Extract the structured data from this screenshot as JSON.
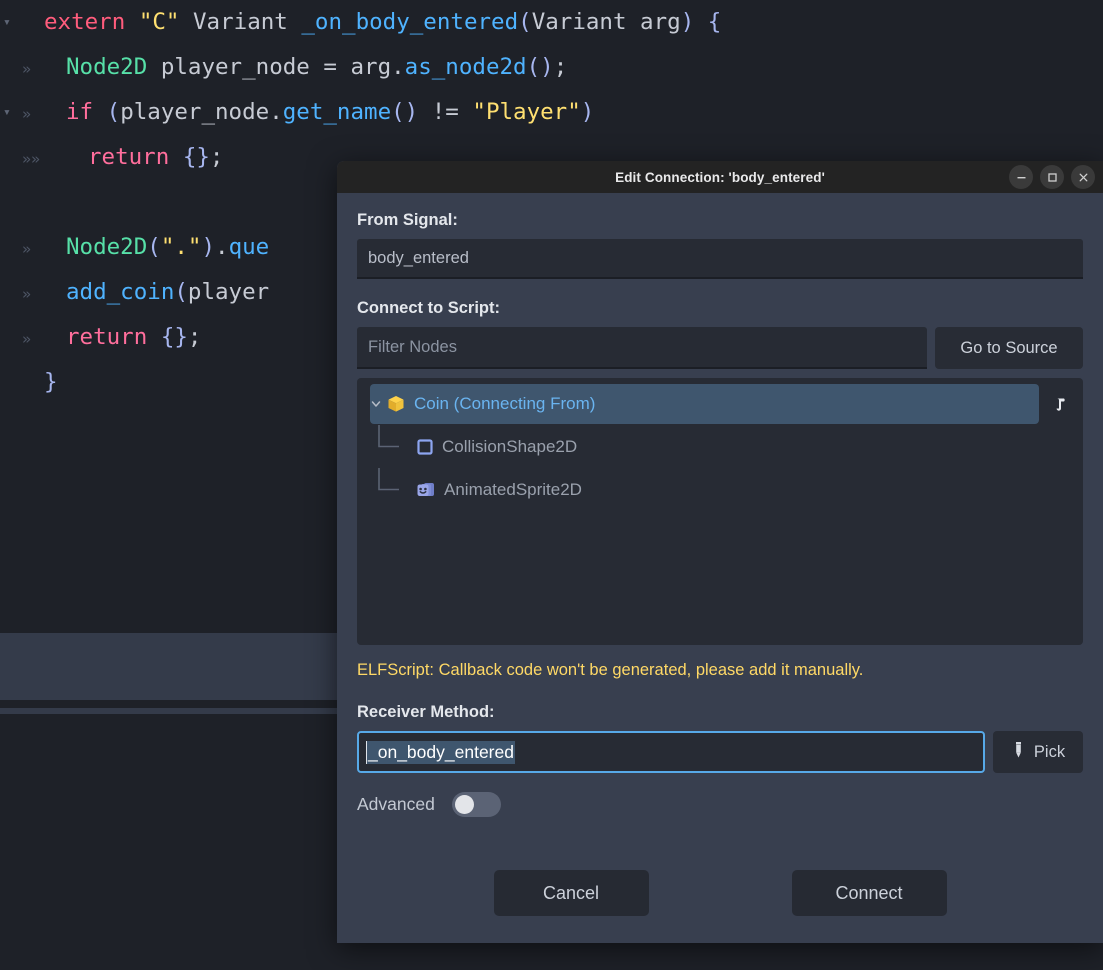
{
  "editor": {
    "lines": [
      {
        "fold": "▾",
        "gutter": "",
        "indent": 0,
        "tokens": [
          {
            "t": "extern",
            "c": "k-kw"
          },
          {
            "t": " ",
            "c": "k-pln"
          },
          {
            "t": "\"C\"",
            "c": "k-str"
          },
          {
            "t": " ",
            "c": "k-pln"
          },
          {
            "t": "Variant",
            "c": "k-type"
          },
          {
            "t": " ",
            "c": "k-pln"
          },
          {
            "t": "_on_body_entered",
            "c": "k-fn"
          },
          {
            "t": "(",
            "c": "k-brc"
          },
          {
            "t": "Variant",
            "c": "k-type"
          },
          {
            "t": " arg",
            "c": "k-pln"
          },
          {
            "t": ")",
            "c": "k-brc"
          },
          {
            "t": " ",
            "c": "k-pln"
          },
          {
            "t": "{",
            "c": "k-brc"
          }
        ]
      },
      {
        "fold": "",
        "gutter": "»",
        "indent": 1,
        "tokens": [
          {
            "t": "Node2D",
            "c": "k-cls"
          },
          {
            "t": " player_node ",
            "c": "k-pln"
          },
          {
            "t": "=",
            "c": "k-op"
          },
          {
            "t": " arg.",
            "c": "k-pln"
          },
          {
            "t": "as_node2d",
            "c": "k-mem"
          },
          {
            "t": "()",
            "c": "k-brc"
          },
          {
            "t": ";",
            "c": "k-pln"
          }
        ]
      },
      {
        "fold": "▾",
        "gutter": "»",
        "indent": 1,
        "tokens": [
          {
            "t": "if",
            "c": "k-kw2"
          },
          {
            "t": " ",
            "c": "k-pln"
          },
          {
            "t": "(",
            "c": "k-brc"
          },
          {
            "t": "player_node.",
            "c": "k-pln"
          },
          {
            "t": "get_name",
            "c": "k-mem"
          },
          {
            "t": "()",
            "c": "k-brc"
          },
          {
            "t": " != ",
            "c": "k-pln"
          },
          {
            "t": "\"Player\"",
            "c": "k-str"
          },
          {
            "t": ")",
            "c": "k-brc"
          }
        ]
      },
      {
        "fold": "",
        "gutter": "»»",
        "indent": 2,
        "tokens": [
          {
            "t": "return",
            "c": "k-kw2"
          },
          {
            "t": " ",
            "c": "k-pln"
          },
          {
            "t": "{}",
            "c": "k-brc"
          },
          {
            "t": ";",
            "c": "k-pln"
          }
        ]
      },
      {
        "fold": "",
        "gutter": "",
        "indent": 0,
        "tokens": []
      },
      {
        "fold": "",
        "gutter": "»",
        "indent": 1,
        "tokens": [
          {
            "t": "Node2D",
            "c": "k-cls"
          },
          {
            "t": "(",
            "c": "k-brc"
          },
          {
            "t": "\".\"",
            "c": "k-str"
          },
          {
            "t": ")",
            "c": "k-brc"
          },
          {
            "t": ".",
            "c": "k-pln"
          },
          {
            "t": "que",
            "c": "k-mem"
          }
        ]
      },
      {
        "fold": "",
        "gutter": "»",
        "indent": 1,
        "tokens": [
          {
            "t": "add_coin",
            "c": "k-fn"
          },
          {
            "t": "(",
            "c": "k-brc"
          },
          {
            "t": "player",
            "c": "k-pln"
          }
        ]
      },
      {
        "fold": "",
        "gutter": "»",
        "indent": 1,
        "tokens": [
          {
            "t": "return",
            "c": "k-kw2"
          },
          {
            "t": " ",
            "c": "k-pln"
          },
          {
            "t": "{}",
            "c": "k-brc"
          },
          {
            "t": ";",
            "c": "k-pln"
          }
        ]
      },
      {
        "fold": "",
        "gutter": "",
        "indent": 0,
        "tokens": [
          {
            "t": "}",
            "c": "k-brc"
          }
        ]
      }
    ]
  },
  "dialog": {
    "title": "Edit Connection: 'body_entered'",
    "window_controls": {
      "minimize": "minimize",
      "maximize": "maximize",
      "close": "close"
    },
    "from_signal": {
      "label": "From Signal:",
      "value": "body_entered"
    },
    "connect_to_script": {
      "label": "Connect to Script:",
      "filter_placeholder": "Filter Nodes",
      "filter_value": "",
      "go_to_source_label": "Go to Source"
    },
    "tree": {
      "nodes": [
        {
          "label": "Coin (Connecting From)",
          "icon": "node2d-cube-icon",
          "selected": true,
          "expanded": true,
          "has_script": true
        },
        {
          "label": "CollisionShape2D",
          "icon": "collision-shape-icon",
          "selected": false
        },
        {
          "label": "AnimatedSprite2D",
          "icon": "animated-sprite-icon",
          "selected": false
        }
      ]
    },
    "warning": "ELFScript: Callback code won't be generated, please add it manually.",
    "receiver_method": {
      "label": "Receiver Method:",
      "value": "_on_body_entered",
      "pick_label": "Pick"
    },
    "advanced": {
      "label": "Advanced",
      "enabled": false
    },
    "footer": {
      "cancel_label": "Cancel",
      "connect_label": "Connect"
    },
    "colors": {
      "accent": "#57a9e8",
      "warning": "#ffd966",
      "selection": "#3f566e",
      "titlebar": "#232323",
      "panel": "#383f4f"
    }
  }
}
